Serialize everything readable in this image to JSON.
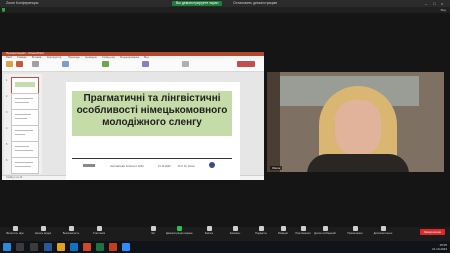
{
  "window": {
    "title": "Zoom Конференция",
    "recording_text": "Вы демонстрируете экран",
    "stop_share": "Остановить демонстрацию",
    "view_label": "Вид"
  },
  "powerpoint": {
    "titlebar": "Презентация1 - PowerPoint",
    "tabs": [
      "Файл",
      "Главная",
      "Вставка",
      "Конструктор",
      "Переходы",
      "Анимация",
      "Слайд-шоу",
      "Рецензирование",
      "Вид"
    ],
    "status": "Слайд 1 из 12",
    "slide": {
      "title": "Прагматичні та лінгвістичні особливості німецькомовного молодіжного сленгу",
      "footer_left": "Internationale Konferenz 2023",
      "footer_date": "21.10.2023",
      "footer_author": "Prof. Dr. Olena"
    },
    "thumbnail_count": 6
  },
  "video": {
    "participant_name": "Olena"
  },
  "controls": [
    {
      "label": "Включить звук",
      "icon": "microphone-icon"
    },
    {
      "label": "Начать видео",
      "icon": "video-camera-icon"
    },
    {
      "label": "Безопасность",
      "icon": "shield-icon"
    },
    {
      "label": "Участники",
      "icon": "participants-icon"
    },
    {
      "label": "Чат",
      "icon": "chat-icon"
    },
    {
      "label": "Демонстрация экрана",
      "icon": "share-screen-icon"
    },
    {
      "label": "Запись",
      "icon": "record-icon"
    },
    {
      "label": "Комнаты",
      "icon": "breakout-rooms-icon"
    },
    {
      "label": "Подкасты",
      "icon": "podcast-icon"
    },
    {
      "label": "Реакции",
      "icon": "reactions-icon"
    },
    {
      "label": "Приложения",
      "icon": "apps-icon"
    },
    {
      "label": "Доска сообщений",
      "icon": "whiteboard-icon"
    },
    {
      "label": "Примечания",
      "icon": "notes-icon"
    },
    {
      "label": "Дополнительно",
      "icon": "more-icon"
    }
  ],
  "end_button": "Завершение",
  "taskbar": {
    "time": "15:05",
    "date": "21.10.2023"
  },
  "colors": {
    "end": "#e02828",
    "recording": "#1e7d3b",
    "slide_band": "#c5dca9",
    "ppt_accent": "#b7472a"
  }
}
